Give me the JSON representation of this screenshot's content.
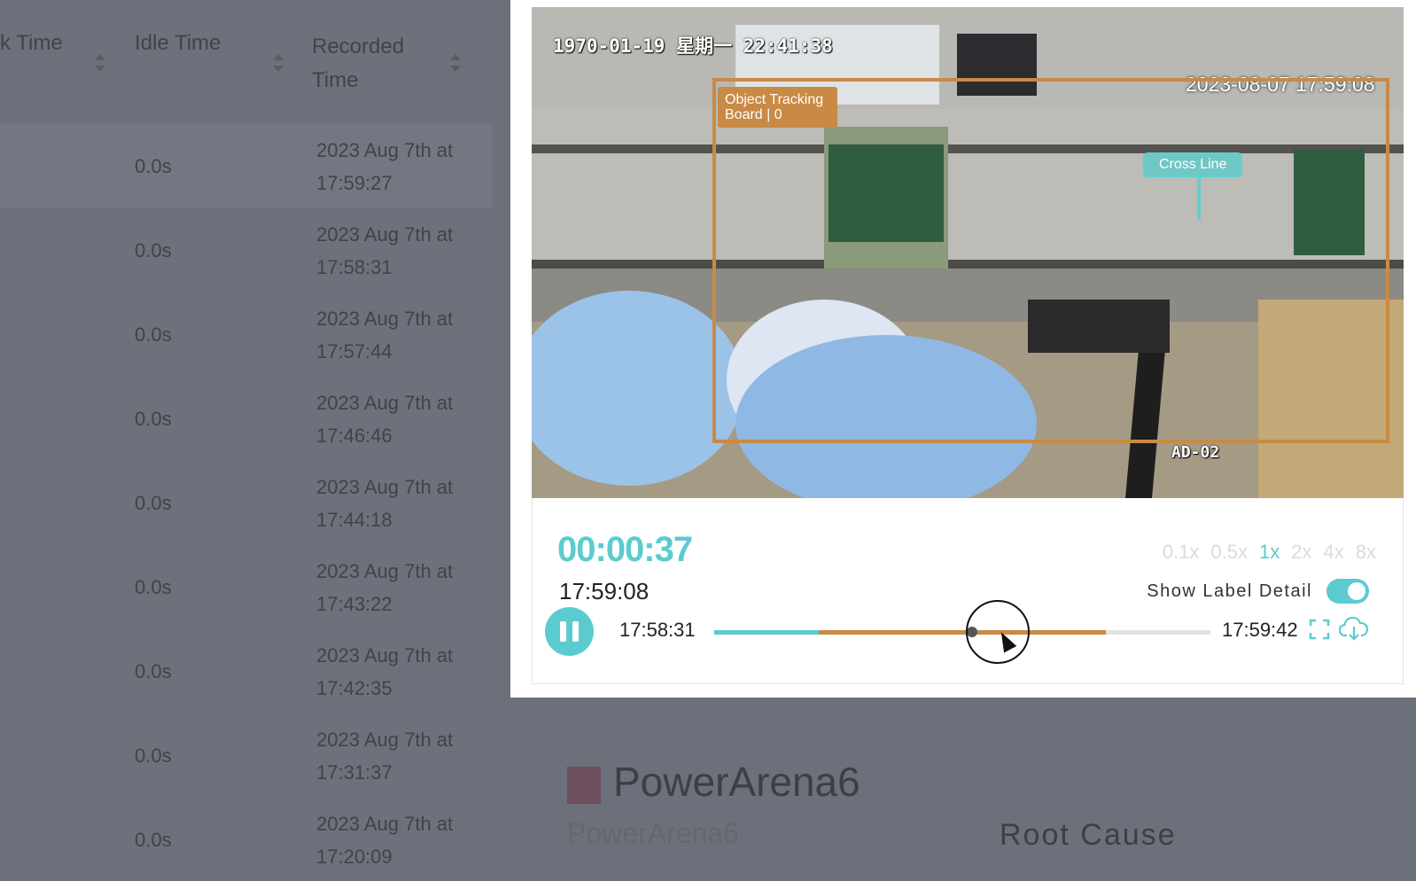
{
  "table": {
    "headers": {
      "col_a": "k Time",
      "idle": "Idle Time",
      "recorded_line1": "Recorded",
      "recorded_line2": "Time"
    },
    "rows": [
      {
        "idle": "0.0s",
        "line1": "2023 Aug 7th at",
        "line2": "17:59:27"
      },
      {
        "idle": "0.0s",
        "line1": "2023 Aug 7th at",
        "line2": "17:58:31"
      },
      {
        "idle": "0.0s",
        "line1": "2023 Aug 7th at",
        "line2": "17:57:44"
      },
      {
        "idle": "0.0s",
        "line1": "2023 Aug 7th at",
        "line2": "17:46:46"
      },
      {
        "idle": "0.0s",
        "line1": "2023 Aug 7th at",
        "line2": "17:44:18"
      },
      {
        "idle": "0.0s",
        "line1": "2023 Aug 7th at",
        "line2": "17:43:22"
      },
      {
        "idle": "0.0s",
        "line1": "2023 Aug 7th at",
        "line2": "17:42:35"
      },
      {
        "idle": "0.0s",
        "line1": "2023 Aug 7th at",
        "line2": "17:31:37"
      },
      {
        "idle": "0.0s",
        "line1": "2023 Aug 7th at",
        "line2": "17:20:09"
      }
    ]
  },
  "video": {
    "osd_datetime": "1970-01-19 星期一 22:41:38",
    "overlay_timestamp": "2023-08-07 17:59:08",
    "camera_label": "AD-02",
    "tracking_label_line1": "Object Tracking",
    "tracking_label_line2": "Board | 0",
    "cross_line_label": "Cross Line"
  },
  "player": {
    "elapsed": "00:00:37",
    "clock": "17:59:08",
    "speeds": [
      "0.1x",
      "0.5x",
      "1x",
      "2x",
      "4x",
      "8x"
    ],
    "active_speed": "1x",
    "label_detail": "Show Label Detail",
    "label_detail_on": true,
    "start_time": "17:58:31",
    "end_time": "17:59:42",
    "cyan_fraction": 0.21,
    "orange_end_fraction": 0.79,
    "playhead_fraction": 0.52,
    "colors": {
      "accent": "#5bcbd0",
      "tracking": "#c88a45"
    },
    "icons": {
      "play_state": "pause-icon",
      "fullscreen": "fullscreen-icon",
      "download": "cloud-download-icon"
    }
  },
  "bottom": {
    "brand": "PowerArena6",
    "brand_sub": "PowerArena6",
    "section": "Root Cause"
  }
}
